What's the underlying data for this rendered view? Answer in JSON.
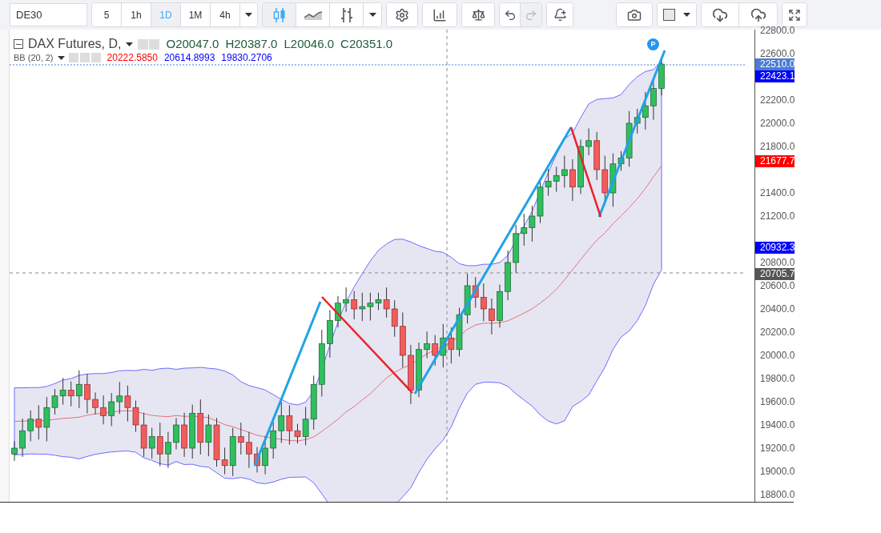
{
  "toolbar": {
    "symbol": "DE30",
    "intervals": [
      {
        "label": "5",
        "selected": false
      },
      {
        "label": "1h",
        "selected": false
      },
      {
        "label": "1D",
        "selected": true
      },
      {
        "label": "1M",
        "selected": false
      },
      {
        "label": "4h",
        "selected": false
      }
    ],
    "chart_types": [
      {
        "kind": "candles",
        "selected": true
      },
      {
        "kind": "area",
        "selected": false
      },
      {
        "kind": "bars",
        "selected": false
      }
    ],
    "redo_disabled": true
  },
  "legend": {
    "title": "DAX Futures, D,",
    "ohlc": [
      {
        "label": "O",
        "value": "20047.0"
      },
      {
        "label": "H",
        "value": "20387.0"
      },
      {
        "label": "L",
        "value": "20046.0"
      },
      {
        "label": "C",
        "value": "20351.0"
      }
    ]
  },
  "indicator": {
    "name": "BB (20, 2)",
    "values": [
      {
        "text": "20222.5850",
        "color": "#ff0000"
      },
      {
        "text": "20614.8993",
        "color": "#0000ff"
      },
      {
        "text": "19830.2706",
        "color": "#0000ff"
      }
    ]
  },
  "marker": "P",
  "price_axis": {
    "ticks": [
      "22800.0",
      "22600.0",
      "22200.0",
      "22000.0",
      "21800.0",
      "21400.0",
      "21200.0",
      "20800.0",
      "20600.0",
      "20400.0",
      "20200.0",
      "20000.0",
      "19800.0",
      "19600.0",
      "19400.0",
      "19200.0",
      "19000.0",
      "18800.0"
    ],
    "badges": [
      {
        "text": "22510.0",
        "color": "#4a7bd6"
      },
      {
        "text": "22423.1",
        "color": "#0000ff"
      },
      {
        "text": "21677.7",
        "color": "#ff0000"
      },
      {
        "text": "20932.3",
        "color": "#0000ff"
      },
      {
        "text": "20705.7",
        "color": "#555555"
      }
    ]
  }
}
